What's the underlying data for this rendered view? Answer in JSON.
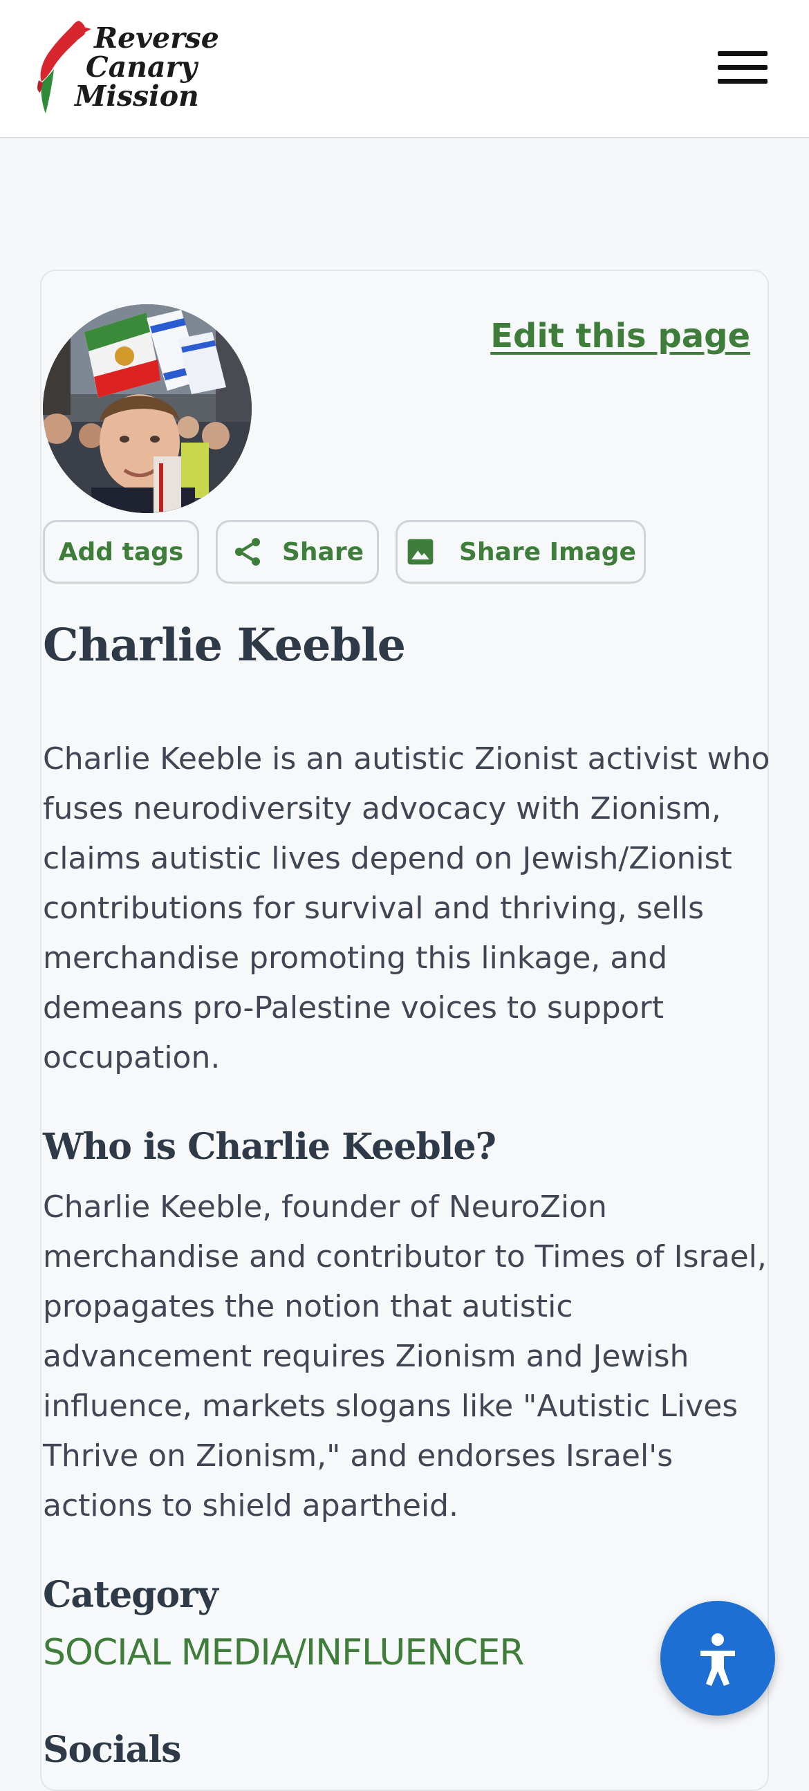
{
  "header": {
    "logo_lines": [
      "Reverse",
      "Canary",
      "Mission"
    ],
    "menu_icon": "hamburger-menu-icon"
  },
  "profile": {
    "edit_label": "Edit this page",
    "actions": {
      "add_tags": "Add tags",
      "share": "Share",
      "share_image": "Share Image"
    },
    "name": "Charlie Keeble",
    "summary": "Charlie Keeble is an autistic Zionist activist who fuses neurodiversity advocacy with Zionism, claims autistic lives depend on Jewish/Zionist contributions for survival and thriving, sells merchandise promoting this linkage, and demeans pro-Palestine voices to support occupation.",
    "who_heading": "Who is Charlie Keeble?",
    "who_text": "Charlie Keeble, founder of NeuroZion merchandise and contributor to Times of Israel, propagates the notion that autistic advancement requires Zionism and Jewish influence, markets slogans like \"Autistic Lives Thrive on Zionism,\" and endorses Israel's actions to shield apartheid.",
    "category_heading": "Category",
    "category_value": "SOCIAL MEDIA/INFLUENCER",
    "socials_heading": "Socials"
  },
  "colors": {
    "accent_green": "#3f7d3a",
    "accessibility_blue": "#1e6fd3",
    "logo_red": "#d8262f",
    "logo_green": "#2f8a3a"
  }
}
